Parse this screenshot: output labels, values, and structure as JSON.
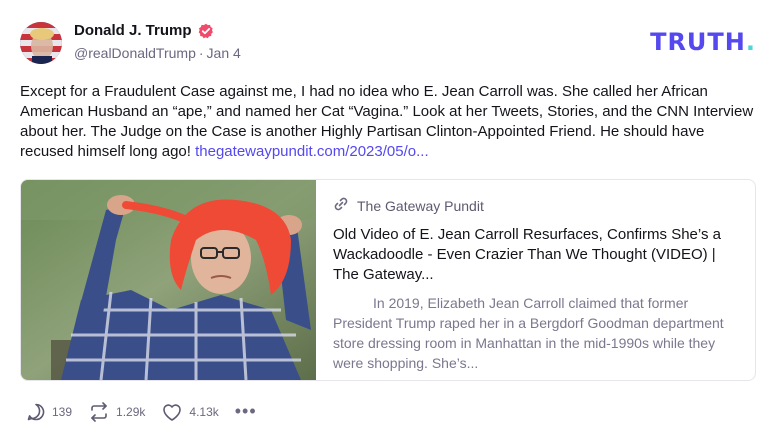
{
  "author": {
    "display_name": "Donald J. Trump",
    "handle": "@realDonaldTrump",
    "date": "Jan 4",
    "verified_color": "#f24a6b"
  },
  "brand": {
    "logo_text": "TRUTH",
    "logo_period": ".",
    "logo_color": "#5448ee",
    "period_color": "#4ad8d4"
  },
  "post": {
    "text": "Except for a Fraudulent Case against me, I had no idea who E. Jean Carroll was. She called her African American Husband an “ape,” and named her Cat “Vagina.” Look at her Tweets, Stories, and the CNN Interview about her. The Judge on the Case is another Highly Partisan Clinton-Appointed Friend. He should have recused himself long ago!",
    "link_text": "thegatewaypundit.com/2023/05/o..."
  },
  "card": {
    "site_name": "The Gateway Pundit",
    "title": "Old Video of E. Jean Carroll Resurfaces, Confirms She’s a Wackadoodle - Even Crazier Than We Thought (VIDEO) | The Gateway...",
    "description": "In 2019, Elizabeth Jean Carroll claimed that former President Trump raped her in a Bergdorf Goodman department store dressing room in Manhattan in the mid-1990s while they were shopping.  She’s..."
  },
  "actions": {
    "replies": "139",
    "retruths": "1.29k",
    "likes": "4.13k",
    "more": "•••"
  }
}
